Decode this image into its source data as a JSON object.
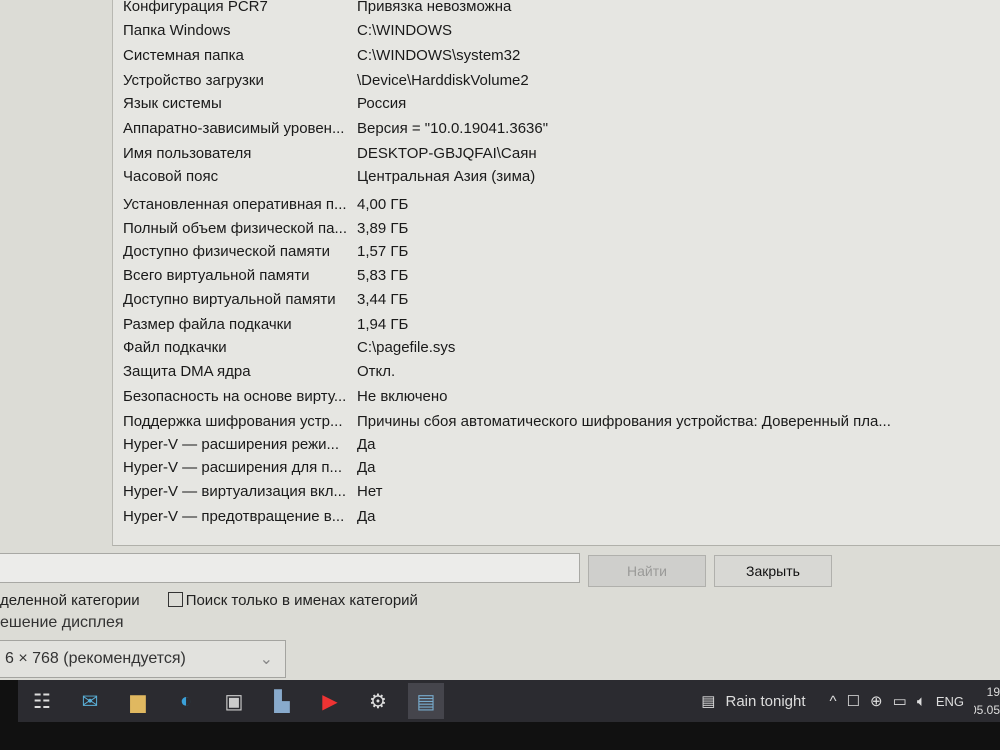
{
  "rows": [
    {
      "k": "Конфигурация PCR7",
      "v": "Привязка невозможна"
    },
    {
      "k": "Папка Windows",
      "v": "C:\\WINDOWS"
    },
    {
      "k": "Системная папка",
      "v": "C:\\WINDOWS\\system32"
    },
    {
      "k": "Устройство загрузки",
      "v": "\\Device\\HarddiskVolume2"
    },
    {
      "k": "Язык системы",
      "v": "Россия"
    },
    {
      "k": "Аппаратно-зависимый уровен...",
      "v": "Версия = \"10.0.19041.3636\""
    },
    {
      "k": "Имя пользователя",
      "v": "DESKTOP-GBJQFAI\\Саян"
    },
    {
      "k": "Часовой пояс",
      "v": "Центральная Азия (зима)"
    },
    {
      "k": "Установленная оперативная п...",
      "v": "4,00 ГБ"
    },
    {
      "k": "Полный объем физической па...",
      "v": "3,89 ГБ"
    },
    {
      "k": "Доступно физической памяти",
      "v": "1,57 ГБ"
    },
    {
      "k": "Всего виртуальной памяти",
      "v": "5,83 ГБ"
    },
    {
      "k": "Доступно виртуальной памяти",
      "v": "3,44 ГБ"
    },
    {
      "k": "Размер файла подкачки",
      "v": "1,94 ГБ"
    },
    {
      "k": "Файл подкачки",
      "v": "C:\\pagefile.sys"
    },
    {
      "k": "Защита DMA ядра",
      "v": "Откл."
    },
    {
      "k": "Безопасность на основе вирту...",
      "v": "Не включено"
    },
    {
      "k": "Поддержка шифрования устр...",
      "v": "Причины сбоя автоматического шифрования устройства: Доверенный пла..."
    },
    {
      "k": "Hyper-V — расширения режи...",
      "v": "Да"
    },
    {
      "k": "Hyper-V — расширения для п...",
      "v": "Да"
    },
    {
      "k": "Hyper-V — виртуализация вкл...",
      "v": "Нет"
    },
    {
      "k": "Hyper-V — предотвращение в...",
      "v": "Да"
    }
  ],
  "search": {
    "value": "",
    "find_label": "Найти",
    "close_label": "Закрыть"
  },
  "options": {
    "selected_category": "деленной категории",
    "names_only": "Поиск только в именах категорий"
  },
  "display": {
    "label": "ешение дисплея",
    "resolution": "6 × 768 (рекомендуется)"
  },
  "taskbar": {
    "weather": "Rain tonight",
    "lang": "ENG",
    "time": "19",
    "date": "05.05"
  }
}
